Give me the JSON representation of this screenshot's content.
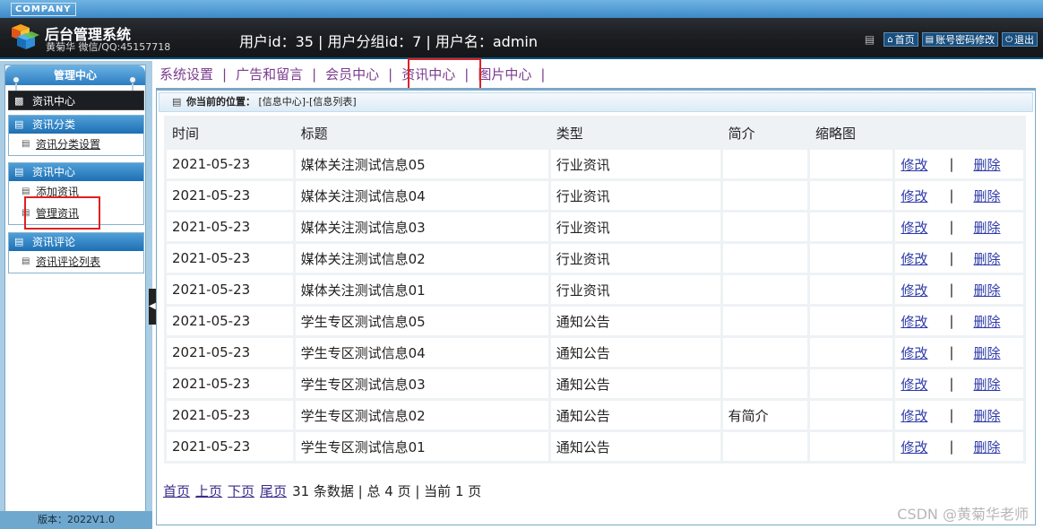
{
  "header": {
    "company": "COMPANY",
    "system_title": "后台管理系统",
    "system_sub": "黄菊华 微信/QQ:45157718",
    "user_info": "用户id：35 | 用户分组id：7 | 用户名：admin",
    "links": [
      {
        "label": "首页",
        "icon": "home-icon"
      },
      {
        "label": "账号密码修改",
        "icon": "account-icon"
      },
      {
        "label": "退出",
        "icon": "power-icon"
      }
    ]
  },
  "sidebar": {
    "header": "管理中心",
    "current": "资讯中心",
    "groups": [
      {
        "title": "资讯分类",
        "items": [
          "资讯分类设置"
        ]
      },
      {
        "title": "资讯中心",
        "items": [
          "添加资讯",
          "管理资讯"
        ]
      },
      {
        "title": "资讯评论",
        "items": [
          "资讯评论列表"
        ]
      }
    ],
    "version": "版本：2022V1.0"
  },
  "topnav": {
    "items": [
      "系统设置",
      "广告和留言",
      "会员中心",
      "资讯中心",
      "图片中心"
    ],
    "active": "资讯中心"
  },
  "breadcrumb": {
    "label": "你当前的位置：",
    "path": "[信息中心]-[信息列表]"
  },
  "table": {
    "columns": [
      "时间",
      "标题",
      "类型",
      "简介",
      "缩略图",
      ""
    ],
    "edit_label": "修改",
    "delete_label": "删除",
    "rows": [
      {
        "time": "2021-05-23",
        "title": "媒体关注测试信息05",
        "type": "行业资讯",
        "intro": "",
        "thumb": ""
      },
      {
        "time": "2021-05-23",
        "title": "媒体关注测试信息04",
        "type": "行业资讯",
        "intro": "",
        "thumb": ""
      },
      {
        "time": "2021-05-23",
        "title": "媒体关注测试信息03",
        "type": "行业资讯",
        "intro": "",
        "thumb": ""
      },
      {
        "time": "2021-05-23",
        "title": "媒体关注测试信息02",
        "type": "行业资讯",
        "intro": "",
        "thumb": ""
      },
      {
        "time": "2021-05-23",
        "title": "媒体关注测试信息01",
        "type": "行业资讯",
        "intro": "",
        "thumb": ""
      },
      {
        "time": "2021-05-23",
        "title": "学生专区测试信息05",
        "type": "通知公告",
        "intro": "",
        "thumb": ""
      },
      {
        "time": "2021-05-23",
        "title": "学生专区测试信息04",
        "type": "通知公告",
        "intro": "",
        "thumb": ""
      },
      {
        "time": "2021-05-23",
        "title": "学生专区测试信息03",
        "type": "通知公告",
        "intro": "",
        "thumb": ""
      },
      {
        "time": "2021-05-23",
        "title": "学生专区测试信息02",
        "type": "通知公告",
        "intro": "有简介",
        "thumb": ""
      },
      {
        "time": "2021-05-23",
        "title": "学生专区测试信息01",
        "type": "通知公告",
        "intro": "",
        "thumb": ""
      }
    ]
  },
  "pager": {
    "first": "首页",
    "prev": "上页",
    "next": "下页",
    "last": "尾页",
    "summary": "31 条数据 | 总 4 页 | 当前 1 页"
  },
  "watermark": "CSDN @黄菊华老师",
  "colors": {
    "accent": "#2c7cc0",
    "highlight": "#e02020",
    "nav_text": "#7a3c8e",
    "link": "#2d3aa8"
  }
}
